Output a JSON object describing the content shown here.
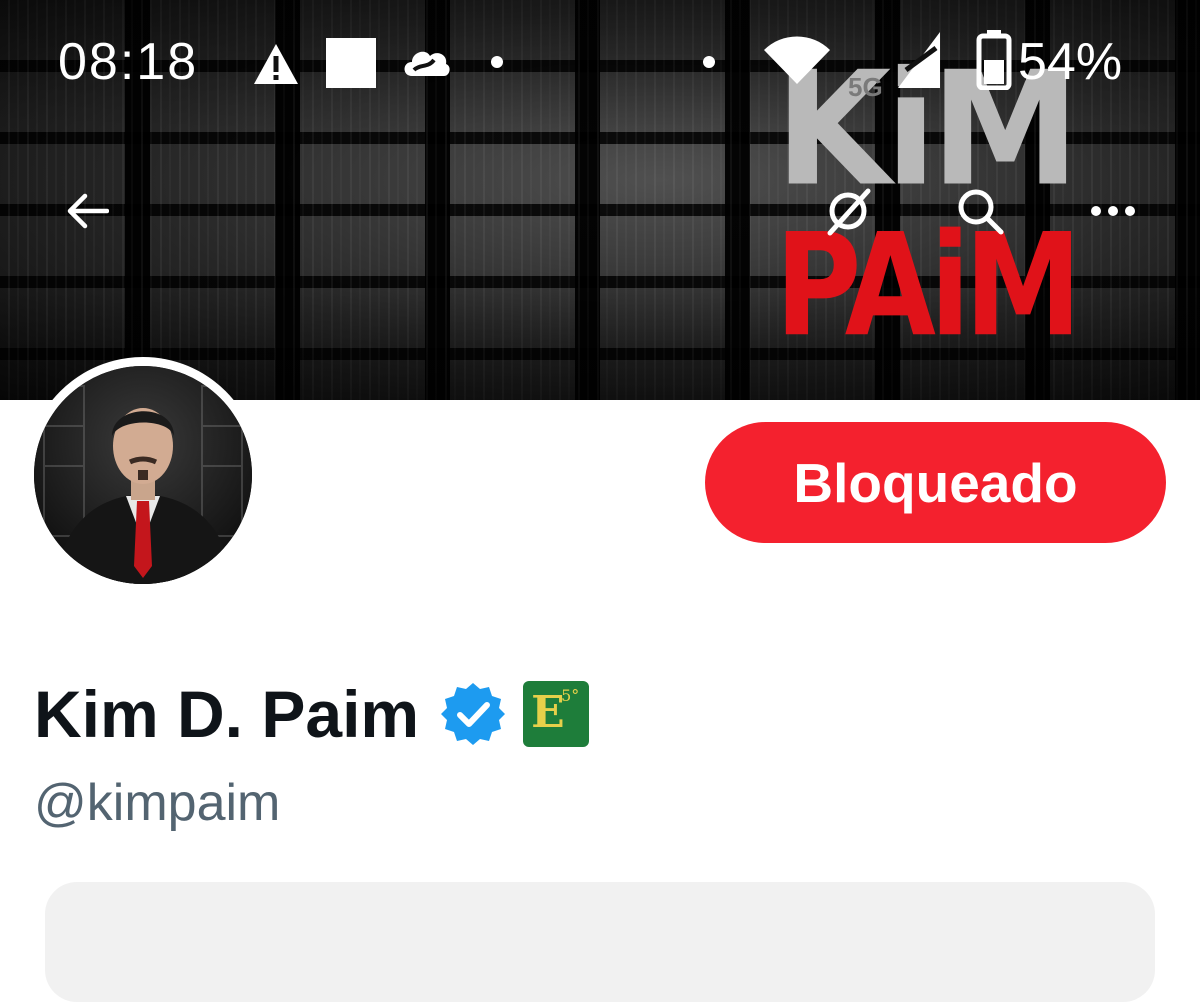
{
  "status_bar": {
    "time": "08:18",
    "battery_percent": "54%",
    "network_label": "5G",
    "icons": [
      "alert-triangle-icon",
      "square-notification-icon",
      "cloud-icon",
      "dot-icon",
      "dot-icon",
      "wifi-icon",
      "signal-icon",
      "battery-icon"
    ]
  },
  "banner": {
    "logo_line1": "KiM",
    "logo_line2": "PAiM",
    "logo_color_top": "#b9b9b9",
    "logo_color_bottom": "#e01219"
  },
  "nav": {
    "icons": [
      "back-arrow-icon",
      "grok-icon",
      "search-icon",
      "more-options-icon"
    ]
  },
  "profile": {
    "display_name": "Kim D. Paim",
    "handle": "@kimpaim",
    "verified": true,
    "verified_color": "#1d9bf0",
    "affiliate_badge_text": "E",
    "affiliate_badge_sup": "5°",
    "action_button_label": "Bloqueado",
    "action_button_color": "#f4212e"
  }
}
